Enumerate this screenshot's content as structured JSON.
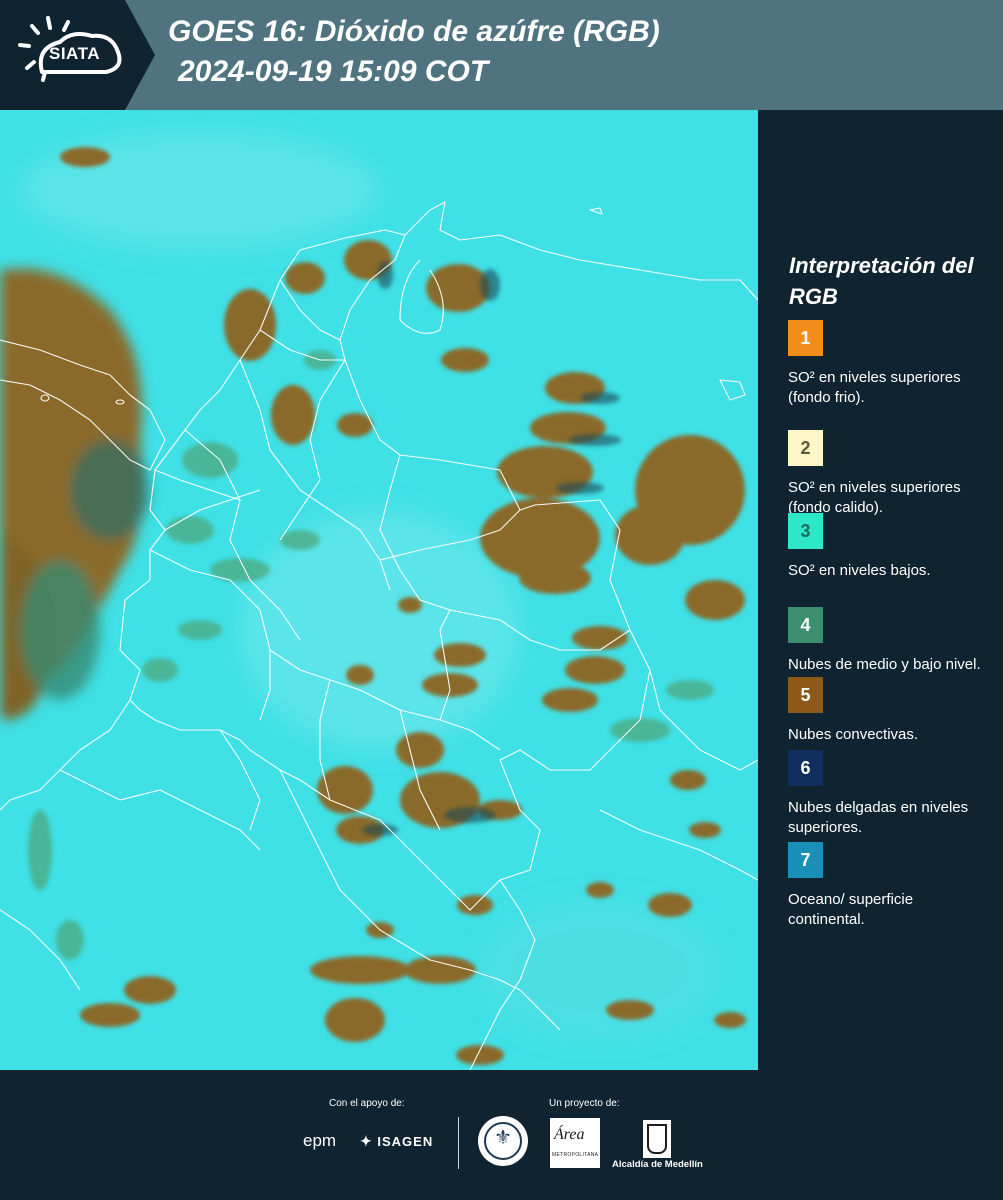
{
  "header": {
    "logo_text": "SIATA",
    "title_line1": "GOES 16: Dióxido de azúfre (RGB)",
    "title_line2": "2024-09-19 15:09 COT"
  },
  "colors": {
    "header_bg": "#4f7480",
    "panel_bg": "#0f2430",
    "map_background": "#36dde4",
    "convective_clouds": "#8a6a2a",
    "cloud_shadow": "#1f4a55",
    "low_clouds": "#5fae8a",
    "borders": "#ffffff"
  },
  "legend": {
    "title": "Interpretación del RGB",
    "items": [
      {
        "number": "1",
        "label": "SO² en niveles superiores (fondo frio).",
        "color": "#f28c1a",
        "text_color": "#ffffff"
      },
      {
        "number": "2",
        "label": "SO² en niveles superiores (fondo calido).",
        "color": "#fff7c8",
        "text_color": "#5a5a40"
      },
      {
        "number": "3",
        "label": "SO² en niveles bajos.",
        "color": "#2ee6c8",
        "text_color": "#1b6d62"
      },
      {
        "number": "4",
        "label": "Nubes de medio y bajo nivel.",
        "color": "#3d8e6e",
        "text_color": "#ffffff"
      },
      {
        "number": "5",
        "label": "Nubes convectivas.",
        "color": "#8c5a16",
        "text_color": "#ffffff"
      },
      {
        "number": "6",
        "label": "Nubes delgadas en niveles superiores.",
        "color": "#102f5e",
        "text_color": "#ffffff"
      },
      {
        "number": "7",
        "label": "Oceano/ superficie continental.",
        "color": "#1990b8",
        "text_color": "#ffffff"
      }
    ]
  },
  "footer": {
    "support_label": "Con el apoyo de:",
    "project_label": "Un proyecto de:",
    "sponsor_epm": "epm",
    "sponsor_isagen": "ISAGEN",
    "sponsor_area": "Área",
    "sponsor_area_sub": "METROPOLITANA",
    "sponsor_alcaldia": "Alcaldía de Medellín"
  }
}
